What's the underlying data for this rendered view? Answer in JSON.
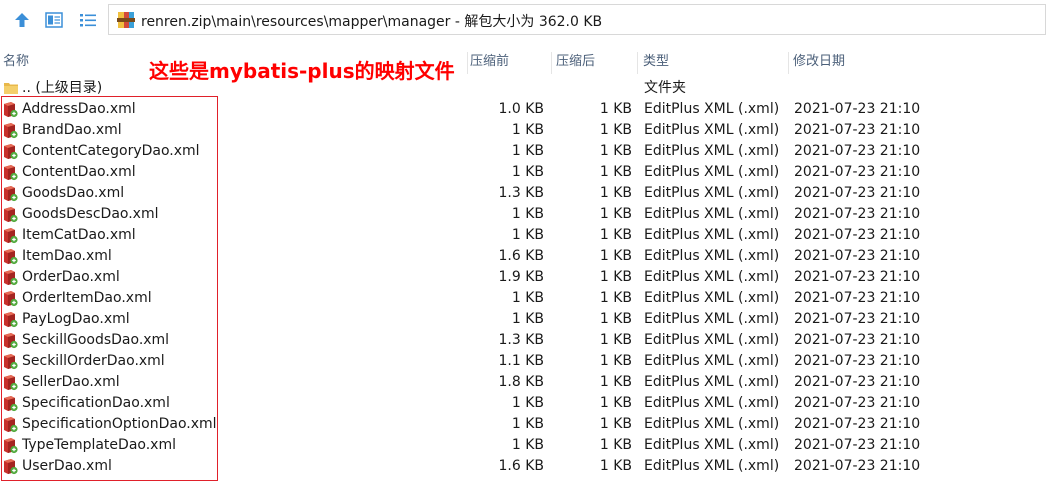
{
  "address": {
    "path": "renren.zip\\main\\resources\\mapper\\manager - 解包大小为 362.0 KB"
  },
  "columns": {
    "name": "名称",
    "compressed": "压缩前",
    "original": "压缩后",
    "type": "类型",
    "modified": "修改日期"
  },
  "annotation": "这些是mybatis-plus的映射文件",
  "parent_row": {
    "name": ".. (上级目录)",
    "type": "文件夹"
  },
  "files": [
    {
      "name": "AddressDao.xml",
      "compressed": "1.0 KB",
      "original": "1 KB",
      "type": "EditPlus XML (.xml)",
      "modified": "2021-07-23 21:10"
    },
    {
      "name": "BrandDao.xml",
      "compressed": "1 KB",
      "original": "1 KB",
      "type": "EditPlus XML (.xml)",
      "modified": "2021-07-23 21:10"
    },
    {
      "name": "ContentCategoryDao.xml",
      "compressed": "1 KB",
      "original": "1 KB",
      "type": "EditPlus XML (.xml)",
      "modified": "2021-07-23 21:10"
    },
    {
      "name": "ContentDao.xml",
      "compressed": "1 KB",
      "original": "1 KB",
      "type": "EditPlus XML (.xml)",
      "modified": "2021-07-23 21:10"
    },
    {
      "name": "GoodsDao.xml",
      "compressed": "1.3 KB",
      "original": "1 KB",
      "type": "EditPlus XML (.xml)",
      "modified": "2021-07-23 21:10"
    },
    {
      "name": "GoodsDescDao.xml",
      "compressed": "1 KB",
      "original": "1 KB",
      "type": "EditPlus XML (.xml)",
      "modified": "2021-07-23 21:10"
    },
    {
      "name": "ItemCatDao.xml",
      "compressed": "1 KB",
      "original": "1 KB",
      "type": "EditPlus XML (.xml)",
      "modified": "2021-07-23 21:10"
    },
    {
      "name": "ItemDao.xml",
      "compressed": "1.6 KB",
      "original": "1 KB",
      "type": "EditPlus XML (.xml)",
      "modified": "2021-07-23 21:10"
    },
    {
      "name": "OrderDao.xml",
      "compressed": "1.9 KB",
      "original": "1 KB",
      "type": "EditPlus XML (.xml)",
      "modified": "2021-07-23 21:10"
    },
    {
      "name": "OrderItemDao.xml",
      "compressed": "1 KB",
      "original": "1 KB",
      "type": "EditPlus XML (.xml)",
      "modified": "2021-07-23 21:10"
    },
    {
      "name": "PayLogDao.xml",
      "compressed": "1 KB",
      "original": "1 KB",
      "type": "EditPlus XML (.xml)",
      "modified": "2021-07-23 21:10"
    },
    {
      "name": "SeckillGoodsDao.xml",
      "compressed": "1.3 KB",
      "original": "1 KB",
      "type": "EditPlus XML (.xml)",
      "modified": "2021-07-23 21:10"
    },
    {
      "name": "SeckillOrderDao.xml",
      "compressed": "1.1 KB",
      "original": "1 KB",
      "type": "EditPlus XML (.xml)",
      "modified": "2021-07-23 21:10"
    },
    {
      "name": "SellerDao.xml",
      "compressed": "1.8 KB",
      "original": "1 KB",
      "type": "EditPlus XML (.xml)",
      "modified": "2021-07-23 21:10"
    },
    {
      "name": "SpecificationDao.xml",
      "compressed": "1 KB",
      "original": "1 KB",
      "type": "EditPlus XML (.xml)",
      "modified": "2021-07-23 21:10"
    },
    {
      "name": "SpecificationOptionDao.xml",
      "compressed": "1 KB",
      "original": "1 KB",
      "type": "EditPlus XML (.xml)",
      "modified": "2021-07-23 21:10"
    },
    {
      "name": "TypeTemplateDao.xml",
      "compressed": "1 KB",
      "original": "1 KB",
      "type": "EditPlus XML (.xml)",
      "modified": "2021-07-23 21:10"
    },
    {
      "name": "UserDao.xml",
      "compressed": "1.6 KB",
      "original": "1 KB",
      "type": "EditPlus XML (.xml)",
      "modified": "2021-07-23 21:10"
    }
  ],
  "colors": {
    "annotation": "#ff0000",
    "highlight_box": "#e0202a",
    "header_text": "#4c607a",
    "up_arrow": "#3b8fd8",
    "folder": "#e8b84a"
  },
  "icons": {
    "up": "up-arrow-icon",
    "view_details": "details-view-icon",
    "view_list": "list-view-icon",
    "archive": "zip-archive-icon",
    "folder": "folder-icon",
    "xml_file": "xml-file-icon"
  }
}
